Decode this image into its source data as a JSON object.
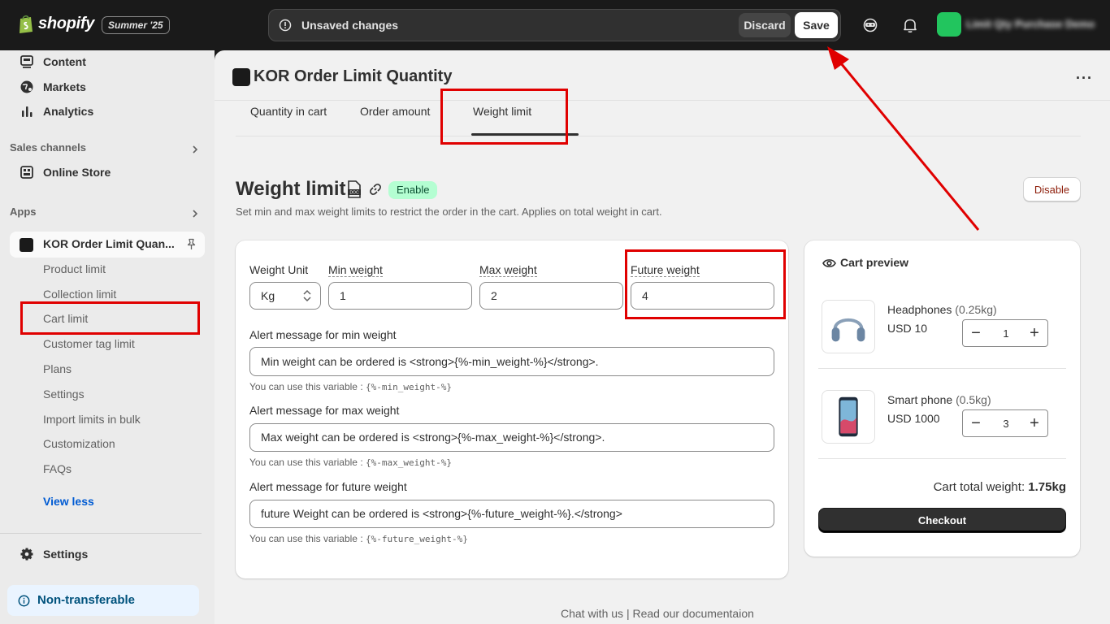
{
  "topbar": {
    "brand": "shopify",
    "edition": "Summer '25",
    "unsaved": "Unsaved changes",
    "discard": "Discard",
    "save": "Save",
    "store_name": "Limit Qty Purchase Demo"
  },
  "sidebar": {
    "items_top": [
      {
        "label": "Content",
        "icon": "content-icon"
      },
      {
        "label": "Markets",
        "icon": "globe-icon"
      },
      {
        "label": "Analytics",
        "icon": "bar-chart-icon"
      }
    ],
    "sales_channels": "Sales channels",
    "online_store": "Online Store",
    "apps": "Apps",
    "app_name": "KOR Order Limit Quan...",
    "subitems": [
      "Product limit",
      "Collection limit",
      "Cart limit",
      "Customer tag limit",
      "Plans",
      "Settings",
      "Import limits in bulk",
      "Customization",
      "FAQs"
    ],
    "view_less": "View less",
    "settings": "Settings",
    "non_transferable": "Non-transferable"
  },
  "app": {
    "title": "KOR Order Limit Quantity",
    "more": "···",
    "tabs": [
      "Quantity in cart",
      "Order amount",
      "Weight limit"
    ],
    "active_tab": "Weight limit"
  },
  "weight": {
    "title": "Weight limit",
    "status": "Enable",
    "description": "Set min and max weight limits to restrict the order in the cart. Applies on total weight in cart.",
    "disable": "Disable",
    "unit_label": "Weight Unit",
    "unit_value": "Kg",
    "min_label": "Min weight",
    "min_value": "1",
    "max_label": "Max weight",
    "max_value": "2",
    "future_label": "Future weight",
    "future_value": "4",
    "alert_min_label": "Alert message for min weight",
    "alert_min_value": "Min weight can be ordered is <strong>{%-min_weight-%}</strong>.",
    "alert_min_help": "You can use this variable :",
    "alert_min_var": "{%-min_weight-%}",
    "alert_max_label": "Alert message for max weight",
    "alert_max_value": "Max weight can be ordered is <strong>{%-max_weight-%}</strong>.",
    "alert_max_help": "You can use this variable :",
    "alert_max_var": "{%-max_weight-%}",
    "alert_future_label": "Alert message for future weight",
    "alert_future_value": "future Weight can be ordered is <strong>{%-future_weight-%}.</strong>",
    "alert_future_help": "You can use this variable :",
    "alert_future_var": "{%-future_weight-%}"
  },
  "cart_preview": {
    "title": "Cart preview",
    "products": [
      {
        "name": "Headphones",
        "weight": "(0.25kg)",
        "price": "USD 10",
        "qty": "1",
        "icon": "headphones-icon"
      },
      {
        "name": "Smart phone",
        "weight": "(0.5kg)",
        "price": "USD 1000",
        "qty": "3",
        "icon": "smartphone-icon"
      }
    ],
    "total_label": "Cart total weight:",
    "total_value": "1.75kg",
    "checkout": "Checkout"
  },
  "footer": {
    "chat": "Chat with us",
    "sep": "|",
    "docs": "Read our documentaion"
  },
  "colors": {
    "highlight": "#e00000",
    "enable_badge_bg": "#b4fed2",
    "link": "#005bd3"
  }
}
